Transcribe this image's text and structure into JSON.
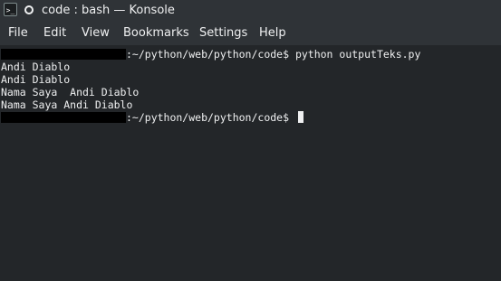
{
  "window": {
    "title": "code : bash — Konsole",
    "app_icon_glyph": ">_",
    "app_icon": "terminal-icon",
    "pin_icon": "pin-icon"
  },
  "menu": {
    "items": [
      "File",
      "Edit",
      "View",
      "Bookmarks",
      "Settings",
      "Help"
    ]
  },
  "terminal": {
    "prompt_path": ":~/python/web/python/code$ ",
    "command": "python outputTeks.py",
    "output": [
      "Andi Diablo",
      "Andi Diablo",
      "Nama Saya  Andi Diablo",
      "Nama Saya Andi Diablo"
    ],
    "prompt_path_2": ":~/python/web/python/code$ "
  },
  "colors": {
    "background": "#232629",
    "chrome": "#2f3337",
    "text": "#eff0f1",
    "redaction": "#000000"
  }
}
